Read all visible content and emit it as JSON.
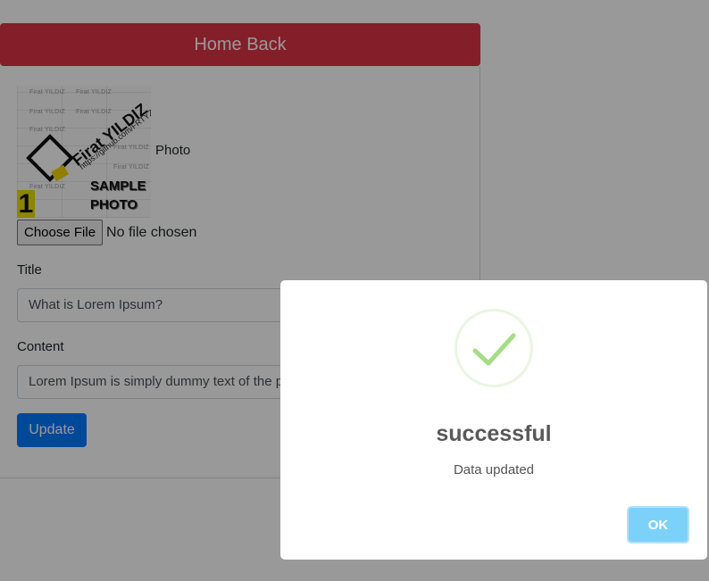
{
  "header": {
    "title": "Home Back"
  },
  "form": {
    "photo_label": "Photo",
    "photo_image": {
      "watermark": "Firat YILDIZ",
      "brand_name": "Firat YILDIZ",
      "url": "https://github.com/FRTYZ",
      "sample_line1": "SAMPLE",
      "sample_line2": "PHOTO",
      "number": "1"
    },
    "choose_file_label": "Choose File",
    "file_status": "No file chosen",
    "title_label": "Title",
    "title_value": "What is Lorem Ipsum?",
    "content_label": "Content",
    "content_value": "Lorem Ipsum is simply dummy text of the printing and typesetting industry.",
    "update_label": "Update"
  },
  "dialog": {
    "icon": "success-check-icon",
    "title": "successful",
    "message": "Data updated",
    "ok_label": "OK"
  },
  "colors": {
    "header": "#dc3545",
    "primary": "#007bff",
    "ok_button": "#7cd1f9",
    "success": "#a5dc86"
  }
}
